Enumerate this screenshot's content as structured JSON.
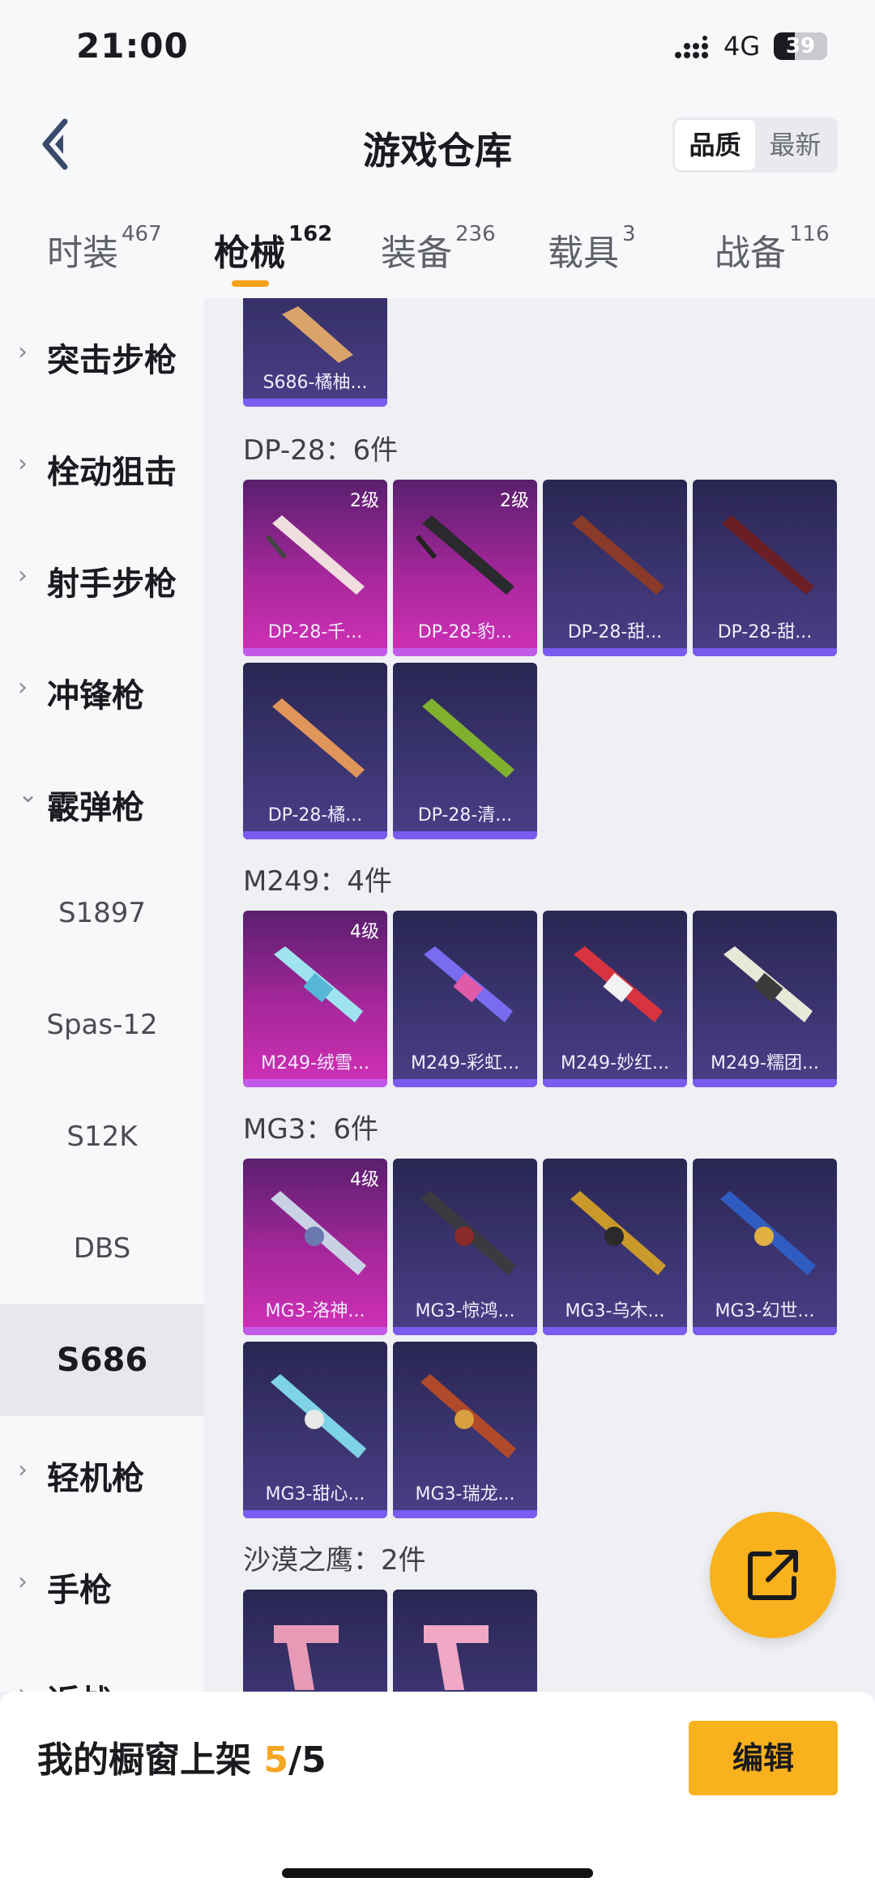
{
  "status": {
    "time": "21:00",
    "network": "4G",
    "battery": "39",
    "battery_level": 0.39
  },
  "header": {
    "title": "游戏仓库",
    "sort_options": [
      "品质",
      "最新"
    ],
    "sort_selected": "品质"
  },
  "tabs": [
    {
      "label": "时装",
      "count": "467"
    },
    {
      "label": "枪械",
      "count": "162",
      "active": true
    },
    {
      "label": "装备",
      "count": "236"
    },
    {
      "label": "载具",
      "count": "3"
    },
    {
      "label": "战备",
      "count": "116"
    }
  ],
  "sidebar": {
    "categories": [
      {
        "label": "突击步枪",
        "icon": "chevron-right-icon"
      },
      {
        "label": "栓动狙击",
        "icon": "chevron-right-icon"
      },
      {
        "label": "射手步枪",
        "icon": "chevron-right-icon"
      },
      {
        "label": "冲锋枪",
        "icon": "chevron-right-icon"
      },
      {
        "label": "霰弹枪",
        "icon": "chevron-down-icon",
        "expanded": true
      },
      {
        "label": "轻机枪",
        "icon": "chevron-right-icon"
      },
      {
        "label": "手枪",
        "icon": "chevron-right-icon"
      },
      {
        "label": "近战",
        "icon": "chevron-right-icon"
      }
    ],
    "subitems": [
      "S1897",
      "Spas-12",
      "S12K",
      "DBS",
      "S686"
    ],
    "active_subitem": "S686"
  },
  "content": {
    "partial_card": {
      "name": "S686-橘柚..."
    },
    "groups": [
      {
        "title": "DP-28：6件",
        "items": [
          {
            "name": "DP-28-千...",
            "level": "2级",
            "rarity": "purple"
          },
          {
            "name": "DP-28-豹...",
            "level": "2级",
            "rarity": "purple"
          },
          {
            "name": "DP-28-甜...",
            "level": "",
            "rarity": "blue"
          },
          {
            "name": "DP-28-甜...",
            "level": "",
            "rarity": "blue"
          },
          {
            "name": "DP-28-橘...",
            "level": "",
            "rarity": "blue"
          },
          {
            "name": "DP-28-清...",
            "level": "",
            "rarity": "blue"
          }
        ]
      },
      {
        "title": "M249：4件",
        "items": [
          {
            "name": "M249-绒雪...",
            "level": "4级",
            "rarity": "purple"
          },
          {
            "name": "M249-彩虹...",
            "level": "",
            "rarity": "blue"
          },
          {
            "name": "M249-妙红...",
            "level": "",
            "rarity": "blue"
          },
          {
            "name": "M249-糯团...",
            "level": "",
            "rarity": "blue"
          }
        ]
      },
      {
        "title": "MG3：6件",
        "items": [
          {
            "name": "MG3-洛神...",
            "level": "4级",
            "rarity": "purple"
          },
          {
            "name": "MG3-惊鸿...",
            "level": "",
            "rarity": "blue"
          },
          {
            "name": "MG3-乌木...",
            "level": "",
            "rarity": "blue"
          },
          {
            "name": "MG3-幻世...",
            "level": "",
            "rarity": "blue"
          },
          {
            "name": "MG3-甜心...",
            "level": "",
            "rarity": "blue"
          },
          {
            "name": "MG3-瑞龙...",
            "level": "",
            "rarity": "blue"
          }
        ]
      },
      {
        "title": "沙漠之鹰：2件",
        "items": [
          {
            "name": "",
            "level": "",
            "rarity": "blue"
          },
          {
            "name": "",
            "level": "",
            "rarity": "blue"
          }
        ]
      }
    ]
  },
  "fab": {
    "icon": "share-icon"
  },
  "bottom": {
    "label": "我的橱窗上架",
    "count": "5",
    "total": "/5",
    "edit_label": "编辑"
  }
}
